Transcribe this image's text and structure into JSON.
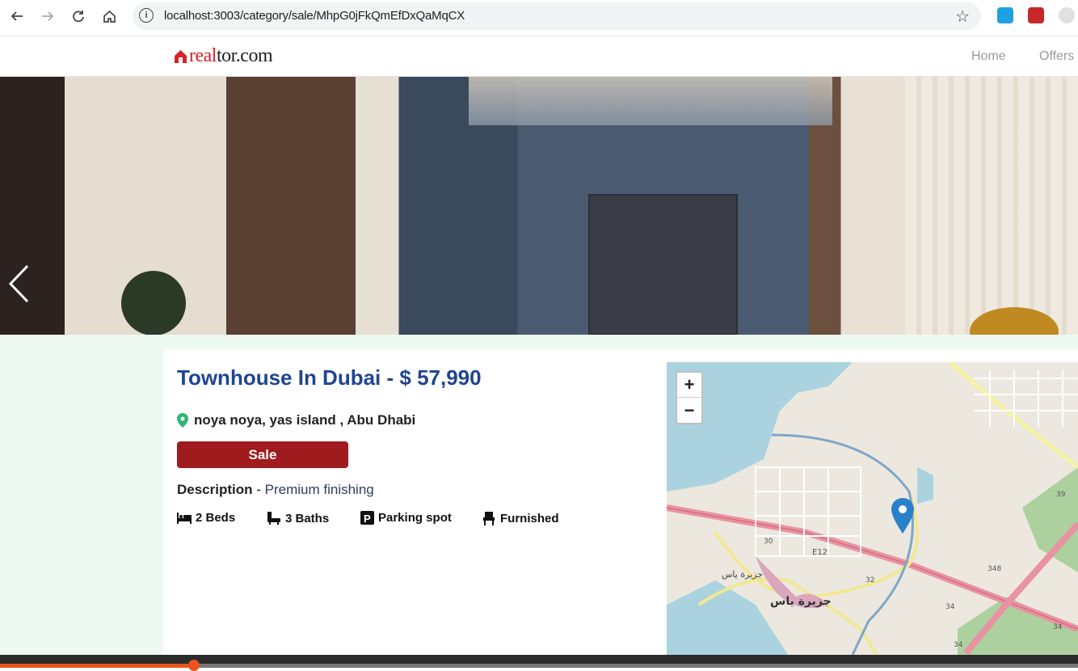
{
  "browser": {
    "url": "localhost:3003/category/sale/MhpG0jFkQmEfDxQaMqCX",
    "back_icon": "arrow-left-icon",
    "forward_icon": "arrow-right-icon",
    "reload_icon": "reload-icon",
    "home_icon": "home-icon",
    "bookmark_icon": "star-icon"
  },
  "header": {
    "logo_part1": "real",
    "logo_part2": "tor.com",
    "nav": [
      "Home",
      "Offers"
    ]
  },
  "listing": {
    "title": "Townhouse In Dubai - $ 57,990",
    "location": "noya noya, yas island , Abu Dhabi",
    "status_label": "Sale",
    "description_label": "Description",
    "description_separator": " - ",
    "description_value": "Premium finishing",
    "features": [
      {
        "label": "2 Beds",
        "icon": "bed-icon"
      },
      {
        "label": "3 Baths",
        "icon": "bath-icon"
      },
      {
        "label": "Parking spot",
        "icon": "parking-icon"
      },
      {
        "label": "Furnished",
        "icon": "chair-icon"
      }
    ]
  },
  "map": {
    "zoom_in": "+",
    "zoom_out": "−",
    "labels": [
      "E12",
      "جزيرة ياس",
      "جزيرة ياس",
      "30",
      "32",
      "34",
      "34",
      "348",
      "39",
      "34"
    ]
  },
  "video": {
    "progress": 0.18
  },
  "colors": {
    "brand_red": "#d92228",
    "title_blue": "#1f4591",
    "sale_red": "#9f1b1e",
    "pin_green": "#2eb872",
    "content_bg": "#eefaf1"
  }
}
